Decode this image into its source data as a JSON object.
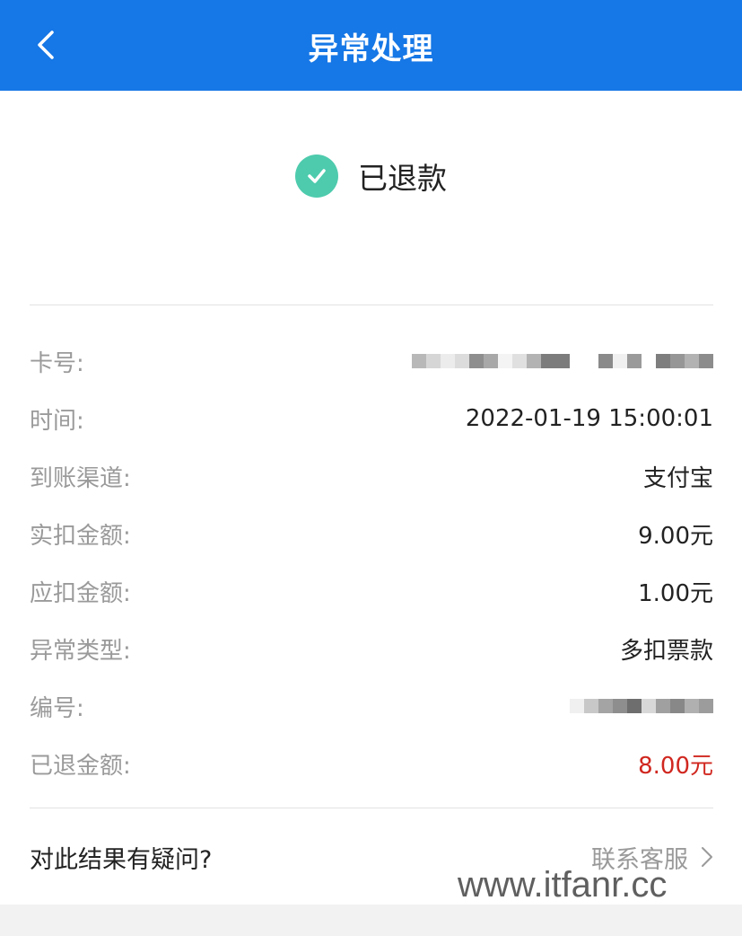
{
  "navbar": {
    "title": "异常处理",
    "back_icon": "chevron-left-icon",
    "color": "#1677e6"
  },
  "status": {
    "icon": "check-circle-icon",
    "text": "已退款",
    "color": "#4ecbad"
  },
  "details": [
    {
      "label": "卡号:",
      "value": "",
      "masked": true
    },
    {
      "label": "时间:",
      "value": "2022-01-19 15:00:01"
    },
    {
      "label": "到账渠道:",
      "value": "支付宝"
    },
    {
      "label": "实扣金额:",
      "value": "9.00元"
    },
    {
      "label": "应扣金额:",
      "value": "1.00元"
    },
    {
      "label": "异常类型:",
      "value": "多扣票款"
    },
    {
      "label": "编号:",
      "value": "",
      "masked": true
    },
    {
      "label": "已退金额:",
      "value": "8.00元",
      "highlight": "#d0271f"
    }
  ],
  "footer": {
    "question": "对此结果有疑问?",
    "link": "联系客服",
    "link_icon": "chevron-right-icon"
  },
  "watermark": "www.itfanr.cc"
}
